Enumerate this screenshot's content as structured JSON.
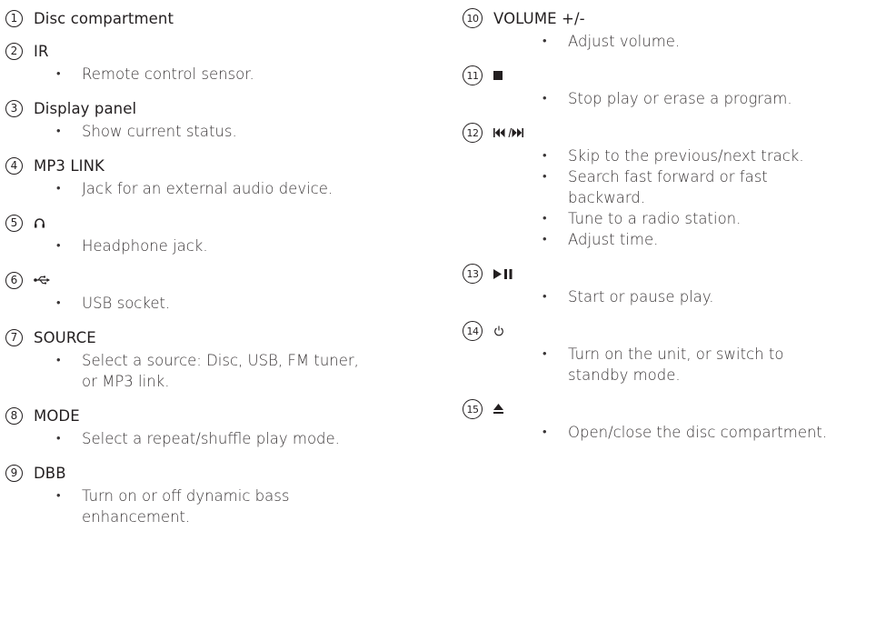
{
  "left": [
    {
      "num": "1",
      "title": "Disc compartment",
      "bullets": []
    },
    {
      "num": "2",
      "title": "IR",
      "bullets": [
        "Remote control sensor."
      ]
    },
    {
      "num": "3",
      "title": "Display panel",
      "bullets": [
        "Show current status."
      ]
    },
    {
      "num": "4",
      "title": "MP3 LINK",
      "bullets": [
        "Jack for an external audio device."
      ]
    },
    {
      "num": "5",
      "title": "",
      "icon": "headphone-icon",
      "bullets": [
        "Headphone jack."
      ]
    },
    {
      "num": "6",
      "title": "",
      "icon": "usb-icon",
      "bullets": [
        "USB socket."
      ]
    },
    {
      "num": "7",
      "title": "SOURCE",
      "bullets": [
        "Select a source: Disc, USB, FM tuner,",
        "or MP3 link."
      ]
    },
    {
      "num": "8",
      "title": "MODE",
      "bullets": [
        "Select a repeat/shuffle play mode."
      ]
    },
    {
      "num": "9",
      "title": "DBB",
      "bullets": [
        "Turn on or off dynamic bass",
        "enhancement."
      ]
    }
  ],
  "right": [
    {
      "num": "10",
      "title": "VOLUME +/-",
      "bullets": [
        "Adjust volume."
      ]
    },
    {
      "num": "11",
      "title": "",
      "icon": "stop-icon",
      "bullets": [
        "Stop play or erase a program."
      ]
    },
    {
      "num": "12",
      "title": "",
      "icon": "skip-icon",
      "bullets": [
        "Skip to the previous/next track.",
        "Search fast forward or fast",
        "backward.",
        "Tune to a radio station.",
        "Adjust time."
      ]
    },
    {
      "num": "13",
      "title": "",
      "icon": "play-pause-icon",
      "bullets": [
        "Start or pause play."
      ]
    },
    {
      "num": "14",
      "title": "",
      "icon": "power-icon",
      "bullets": [
        "Turn on the unit, or switch to",
        "standby mode."
      ]
    },
    {
      "num": "15",
      "title": "",
      "icon": "eject-icon",
      "bullets": [
        "Open/close the disc compartment."
      ]
    }
  ],
  "bullet_char": "•"
}
